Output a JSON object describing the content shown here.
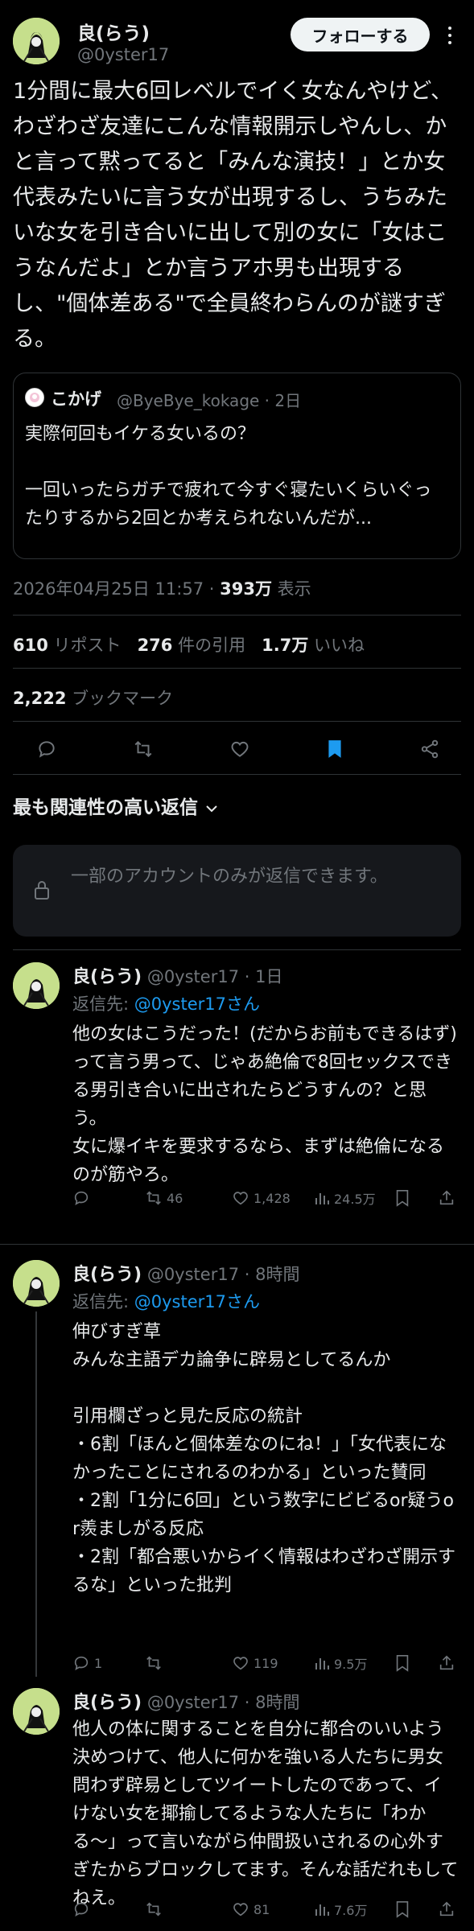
{
  "tweet": {
    "author_name": "良(らう)",
    "author_handle": "@0yster17",
    "follow_label": "フォローする",
    "text": "1分間に最大6回レベルでイく女なんやけど、わざわざ友達にこんな情報開示しやんし、かと言って黙ってると「みんな演技！」とか女代表みたいに言う女が出現するし、うちみたいな女を引き合いに出して別の女に「女はこうなんだよ」とか言うアホ男も出現するし、\"個体差ある\"で全員終わらんのが謎すぎる。",
    "timestamp": "2026年04月25日 11:57 · ",
    "views_count": "393万",
    "views_label": " 表示",
    "reposts_count": "610",
    "reposts_label": " リポスト",
    "quotes_count": "276",
    "quotes_label": " 件の引用",
    "likes_count": "1.7万",
    "likes_label": " いいね",
    "bookmarks_count": "2,222",
    "bookmarks_label": " ブックマーク"
  },
  "quote": {
    "name": "こかげ",
    "meta": "@ByeBye_kokage · 2日",
    "text": "実際何回もイケる女いるの？\n\n一回いったらガチで疲れて今すぐ寝たいくらいぐったりするから2回とか考えられないんだが..."
  },
  "icons": [
    "reply-icon",
    "repost-icon",
    "like-icon",
    "bookmark-icon",
    "share-icon",
    "chevron-down-icon",
    "lock-icon",
    "views-icon",
    "more-icon"
  ],
  "colors": {
    "accent": "#1d9bf0",
    "background": "#000000",
    "muted": "#71767b",
    "avatar_bg": "#c6df8c"
  },
  "replies_section": {
    "sort_label": "最も関連性の高い返信",
    "restricted_text": "一部のアカウントのみが返信できます。"
  },
  "replies": [
    {
      "name": "良(らう)",
      "meta": "@0yster17 · 1日",
      "reply_to_label": "返信先: ",
      "reply_to_handle": "@0yster17さん",
      "text": "他の女はこうだった！(だからお前もできるはず)って言う男って、じゃあ絶倫で8回セックスできる男引き合いに出されたらどうすんの？と思う。\n女に爆イキを要求するなら、まずは絶倫になるのが筋やろ。",
      "replies": "",
      "reposts": "46",
      "likes": "1,428",
      "views": "24.5万"
    },
    {
      "name": "良(らう)",
      "meta": "@0yster17 · 8時間",
      "reply_to_label": "返信先: ",
      "reply_to_handle": "@0yster17さん",
      "text": "伸びすぎ草\nみんな主語デカ論争に辟易としてるんか\n\n引用欄ざっと見た反応の統計\n・6割「ほんと個体差なのにね！」「女代表になかったことにされるのわかる」といった賛同\n・2割「1分に6回」という数字にビビるor疑うor羨ましがる反応\n・2割「都合悪いからイく情報はわざわざ開示するな」といった批判",
      "replies": "1",
      "reposts": "",
      "likes": "119",
      "views": "9.5万"
    },
    {
      "name": "良(らう)",
      "meta": "@0yster17 · 8時間",
      "text": "他人の体に関することを自分に都合のいいよう決めつけて、他人に何かを強いる人たちに男女問わず辟易としてツイートしたのであって、イけない女を揶揄してるような人たちに「わかる〜」って言いながら仲間扱いされるの心外すぎたからブロックしてます。そんな話だれもしてねえ。",
      "replies": "",
      "reposts": "",
      "likes": "81",
      "views": "7.6万"
    }
  ]
}
